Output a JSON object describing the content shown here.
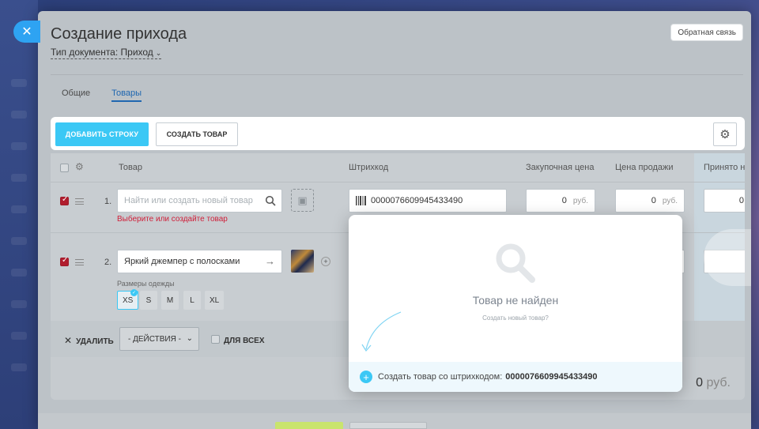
{
  "header": {
    "title": "Создание прихода",
    "doc_type": "Тип документа: Приход",
    "feedback": "Обратная связь"
  },
  "tabs": [
    {
      "label": "Общие",
      "active": false
    },
    {
      "label": "Товары",
      "active": true
    }
  ],
  "toolbar": {
    "add_row": "ДОБАВИТЬ СТРОКУ",
    "create_product": "СОЗДАТЬ ТОВАР"
  },
  "grid": {
    "columns": {
      "product": "Товар",
      "barcode": "Штрихкод",
      "purchase_price": "Закупочная цена",
      "sale_price": "Цена продажи",
      "accepted": "Принято н"
    },
    "rows": [
      {
        "num": "1.",
        "product_placeholder": "Найти или создать новый товар",
        "error": "Выберите или создайте товар",
        "barcode": "0000076609945433490",
        "purchase_price": "0",
        "sale_price": "0",
        "currency": "руб.",
        "accepted": "0"
      },
      {
        "num": "2.",
        "product": "Яркий джемпер с полосками",
        "sizes_label": "Размеры одежды",
        "sizes": [
          "XS",
          "S",
          "M",
          "L",
          "XL"
        ],
        "selected_size": "XS"
      }
    ]
  },
  "footer": {
    "delete": "УДАЛИТЬ",
    "actions": "- ДЕЙСТВИЯ -",
    "for_all": "ДЛЯ ВСЕХ",
    "total_value": "0",
    "total_currency": "руб."
  },
  "popup": {
    "title": "Товар не найден",
    "link": "Создать новый товар?",
    "create_text": "Создать товар со штрихкодом:",
    "create_barcode": "0000076609945433490"
  },
  "colors": {
    "accent": "#3bc8f5",
    "link": "#2067b0",
    "error": "#d0203a",
    "checkbox": "#b01d2e"
  }
}
